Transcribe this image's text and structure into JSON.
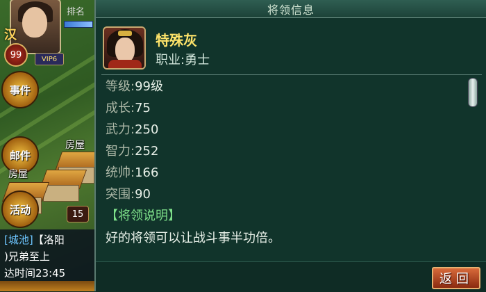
{
  "background": {
    "kingdom": "汉",
    "player_level": "99",
    "vip": "VIP6",
    "rank_label": "排名",
    "house_label_1": "房屋",
    "house_label_2": "房屋",
    "side_buttons": [
      "事件",
      "邮件",
      "活动"
    ],
    "building_count": "15",
    "chat": {
      "line1_tag": "[城池]",
      "line1_text": "【洛阳",
      "line2_text": ")兄弟至上",
      "line3_text": "达时间23:45"
    }
  },
  "dialog": {
    "title": "将领信息",
    "general": {
      "name": "特殊灰",
      "profession": "职业:勇士"
    },
    "stats": [
      {
        "label": "等级:",
        "value": "99级"
      },
      {
        "label": "成长:",
        "value": "75"
      },
      {
        "label": "武力:",
        "value": "250"
      },
      {
        "label": "智力:",
        "value": "252"
      },
      {
        "label": "统帅:",
        "value": "166"
      },
      {
        "label": "突围:",
        "value": "90"
      }
    ],
    "description_title": "【将领说明】",
    "description_text": "好的将领可以让战斗事半功倍。",
    "back_label": "返回"
  },
  "colors": {
    "dialog_bg": "#11342b",
    "name": "#ffe46a",
    "desc_title": "#7ee08a",
    "back_button": "#c0501f"
  }
}
